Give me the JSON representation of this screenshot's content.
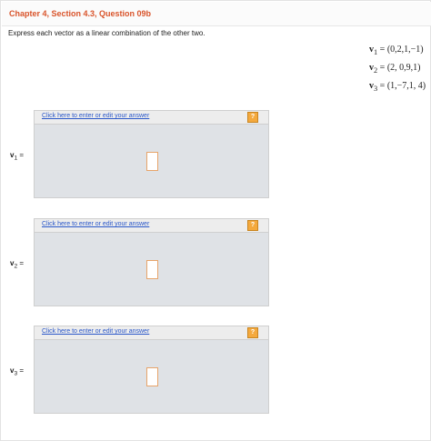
{
  "header": {
    "title": "Chapter 4, Section 4.3, Question 09b"
  },
  "question": {
    "instructions": "Express each vector as a linear combination of the other two."
  },
  "vectors": [
    {
      "name": "v",
      "sub": "1",
      "eq": "=",
      "value": "(0,2,1,−1)"
    },
    {
      "name": "v",
      "sub": "2",
      "eq": "=",
      "value": "(2, 0,9,1)"
    },
    {
      "name": "v",
      "sub": "3",
      "eq": "=",
      "value": "(1,−7,1, 4)"
    }
  ],
  "answers": [
    {
      "label_name": "v",
      "label_sub": "1",
      "label_eq": "=",
      "link_text": "Click here to enter or edit your answer",
      "help_text": "?"
    },
    {
      "label_name": "v",
      "label_sub": "2",
      "label_eq": "=",
      "link_text": "Click here to enter or edit your answer",
      "help_text": "?"
    },
    {
      "label_name": "v",
      "label_sub": "3",
      "label_eq": "=",
      "link_text": "Click here to enter or edit your answer",
      "help_text": "?"
    }
  ]
}
